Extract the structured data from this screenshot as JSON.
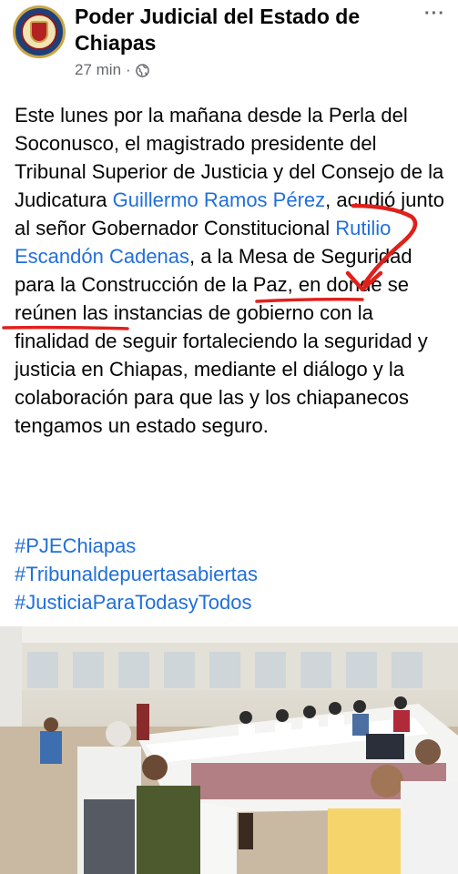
{
  "post": {
    "page_name": "Poder Judicial del Estado de Chiapas",
    "time": "27 min",
    "separator": "·",
    "more": "···",
    "text": {
      "t1": "Este lunes por la mañana desde la Perla del Soconusco, el magistrado presidente del Tribunal Superior de Justicia y del Consejo de la Judicatura ",
      "m1": "Guillermo Ramos Pérez",
      "t2": ", acudió junto al señor Gobernador Constitucional ",
      "m2": "Rutilio Escandón Cadenas",
      "t3": ", a la Mesa de Seguridad para la Construcción de la Paz, en donde se reúnen las instancias de gobierno con la finalidad de seguir fortaleciendo la seguridad y justicia en Chiapas, mediante el diálogo y la colaboración para que las y los chiapanecos tengamos un estado seguro."
    },
    "hashtags": [
      "#PJEChiapas",
      "#Tribunaldepuertasabiertas",
      "#JusticiaParaTodasyTodos"
    ]
  },
  "colors": {
    "link": "#216fdb",
    "annotation": "#e0201b",
    "meta": "#65676b"
  },
  "icons": {
    "avatar": "court-seal-logo",
    "globe": "globe-icon",
    "more": "more-options-icon"
  }
}
